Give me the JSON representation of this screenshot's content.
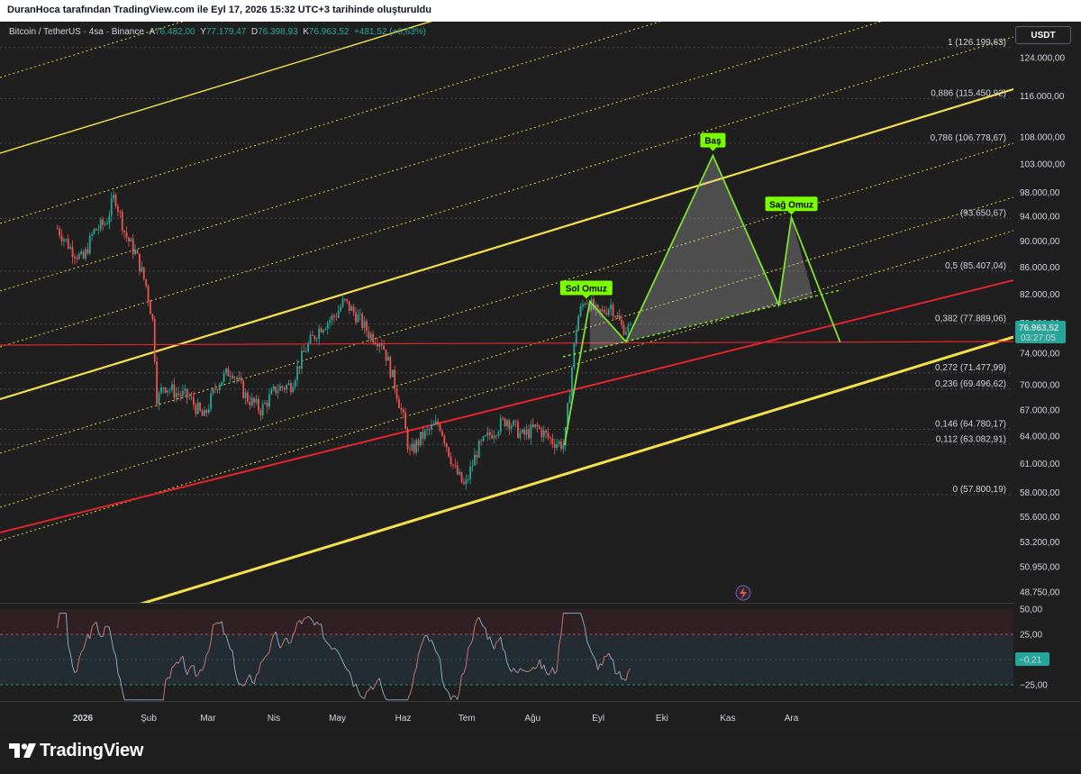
{
  "header": {
    "title": "DuranHoca tarafından TradingView.com ile Eyl 17, 2026 15:32 UTC+3 tarihinde oluşturuldu"
  },
  "legend": {
    "symbol": "Bitcoin / TetherUS · 4sa · Binance",
    "open_label": "A",
    "open": "76.482,00",
    "high_label": "Y",
    "high": "77.179,47",
    "low_label": "D",
    "low": "76.398,93",
    "close_label": "K",
    "close": "76.963,52",
    "change": "+481,52 (+0,63%)"
  },
  "currency_button": "USDT",
  "brand": {
    "name": "TradingView"
  },
  "colors": {
    "up": "#26a69a",
    "down": "#ef5350",
    "channel": "#f4e04d",
    "channel_outer_green": "#2e7d32",
    "trend_red": "#e3242b",
    "pattern": "#7fe02e",
    "bubble": "#7cfc00",
    "price_label": "#26a69a",
    "rsi_band": "#263742",
    "rsi_line": "#7b9aa8",
    "background": "#1f1f1f"
  },
  "chart_data": [
    {
      "type": "line",
      "title": "",
      "series_kind": "candlestick_price",
      "x_labels": [
        "2026",
        "Şub",
        "Mar",
        "Nis",
        "May",
        "Haz",
        "Tem",
        "Ağu",
        "Eyl",
        "Eki",
        "Kas",
        "Ara"
      ],
      "y_ticks": [
        "124.000,00",
        "116.000,00",
        "108.000,00",
        "103.000,00",
        "98.000,00",
        "94.000,00",
        "90.000,00",
        "86.000,00",
        "82.000,00",
        "78.000,00",
        "74.000,00",
        "70.000,00",
        "67.000,00",
        "64.000,00",
        "61.000,00",
        "58.000,00",
        "55.600,00",
        "53.200,00",
        "50.950,00",
        "48.750,00"
      ],
      "y_scale": "log",
      "ylim": [
        48000,
        128000
      ],
      "price_path": [
        [
          "2025-12-20",
          92000
        ],
        [
          "2025-12-26",
          89000
        ],
        [
          "2026-01-01",
          87000
        ],
        [
          "2026-01-06",
          91500
        ],
        [
          "2026-01-12",
          93000
        ],
        [
          "2026-01-16",
          97500
        ],
        [
          "2026-01-21",
          91000
        ],
        [
          "2026-01-26",
          88000
        ],
        [
          "2026-01-31",
          83000
        ],
        [
          "2026-02-03",
          78000
        ],
        [
          "2026-02-05",
          68000
        ],
        [
          "2026-02-08",
          70000
        ],
        [
          "2026-02-14",
          69000
        ],
        [
          "2026-02-20",
          68500
        ],
        [
          "2026-02-27",
          66000
        ],
        [
          "2026-03-05",
          70000
        ],
        [
          "2026-03-12",
          72000
        ],
        [
          "2026-03-19",
          68500
        ],
        [
          "2026-03-26",
          67000
        ],
        [
          "2026-04-02",
          69500
        ],
        [
          "2026-04-09",
          70000
        ],
        [
          "2026-04-16",
          74500
        ],
        [
          "2026-04-23",
          77500
        ],
        [
          "2026-04-30",
          79000
        ],
        [
          "2026-05-04",
          81000
        ],
        [
          "2026-05-10",
          79000
        ],
        [
          "2026-05-16",
          76500
        ],
        [
          "2026-05-22",
          75500
        ],
        [
          "2026-05-28",
          70000
        ],
        [
          "2026-06-01",
          66000
        ],
        [
          "2026-06-04",
          62000
        ],
        [
          "2026-06-10",
          64000
        ],
        [
          "2026-06-18",
          65500
        ],
        [
          "2026-06-25",
          60500
        ],
        [
          "2026-06-30",
          58500
        ],
        [
          "2026-07-06",
          62500
        ],
        [
          "2026-07-13",
          64500
        ],
        [
          "2026-07-20",
          66000
        ],
        [
          "2026-07-27",
          64000
        ],
        [
          "2026-08-03",
          65000
        ],
        [
          "2026-08-10",
          63500
        ],
        [
          "2026-08-16",
          63000
        ],
        [
          "2026-08-22",
          78500
        ],
        [
          "2026-08-26",
          81500
        ],
        [
          "2026-09-01",
          79000
        ],
        [
          "2026-09-07",
          80500
        ],
        [
          "2026-09-12",
          77500
        ],
        [
          "2026-09-17",
          76963.52
        ]
      ],
      "current_price": "76.963,52",
      "countdown": "03:27:05",
      "fib_levels": [
        {
          "label": "1 (126.199,63)",
          "value": 126199.63
        },
        {
          "label": "0,886 (115.450,92)",
          "value": 115450.92
        },
        {
          "label": "0,786 (106.778,67)",
          "value": 106778.67
        },
        {
          "label": "(93.650,67)",
          "value": 93650.67
        },
        {
          "label": "0,5 (85.407,04)",
          "value": 85407.04
        },
        {
          "label": "0,382 (77.889,06)",
          "value": 77889.06
        },
        {
          "label": "0,272 (71.477,99)",
          "value": 71477.99
        },
        {
          "label": "0,236 (69.496,62)",
          "value": 69496.62
        },
        {
          "label": "0,146 (64.780,17)",
          "value": 64780.17
        },
        {
          "label": "0,112 (63.082,91)",
          "value": 63082.91
        },
        {
          "label": "0 (57.800,19)",
          "value": 57800.19
        }
      ],
      "horizontal_line": 75800,
      "head_and_shoulders": {
        "left_shoulder": {
          "label": "Sol Omuz",
          "date": "2026-08-28",
          "price": 81000
        },
        "head": {
          "label": "Baş",
          "date": "2026-10-25",
          "price": 104500
        },
        "right_shoulder": {
          "label": "Sağ Omuz",
          "date": "2026-12-01",
          "price": 93800
        },
        "path": [
          [
            "2026-08-16",
            63000
          ],
          [
            "2026-08-28",
            81000
          ],
          [
            "2026-09-14",
            75500
          ],
          [
            "2026-10-25",
            104500
          ],
          [
            "2026-11-25",
            80500
          ],
          [
            "2026-12-01",
            93800
          ],
          [
            "2026-12-24",
            75400
          ]
        ]
      }
    },
    {
      "type": "line",
      "title": "",
      "series_kind": "oscillator",
      "y_ticks": [
        "50,00",
        "25,00",
        "−25,00"
      ],
      "ylim": [
        -45,
        55
      ],
      "band": [
        -25,
        25
      ],
      "current_value": "−0,21"
    }
  ]
}
